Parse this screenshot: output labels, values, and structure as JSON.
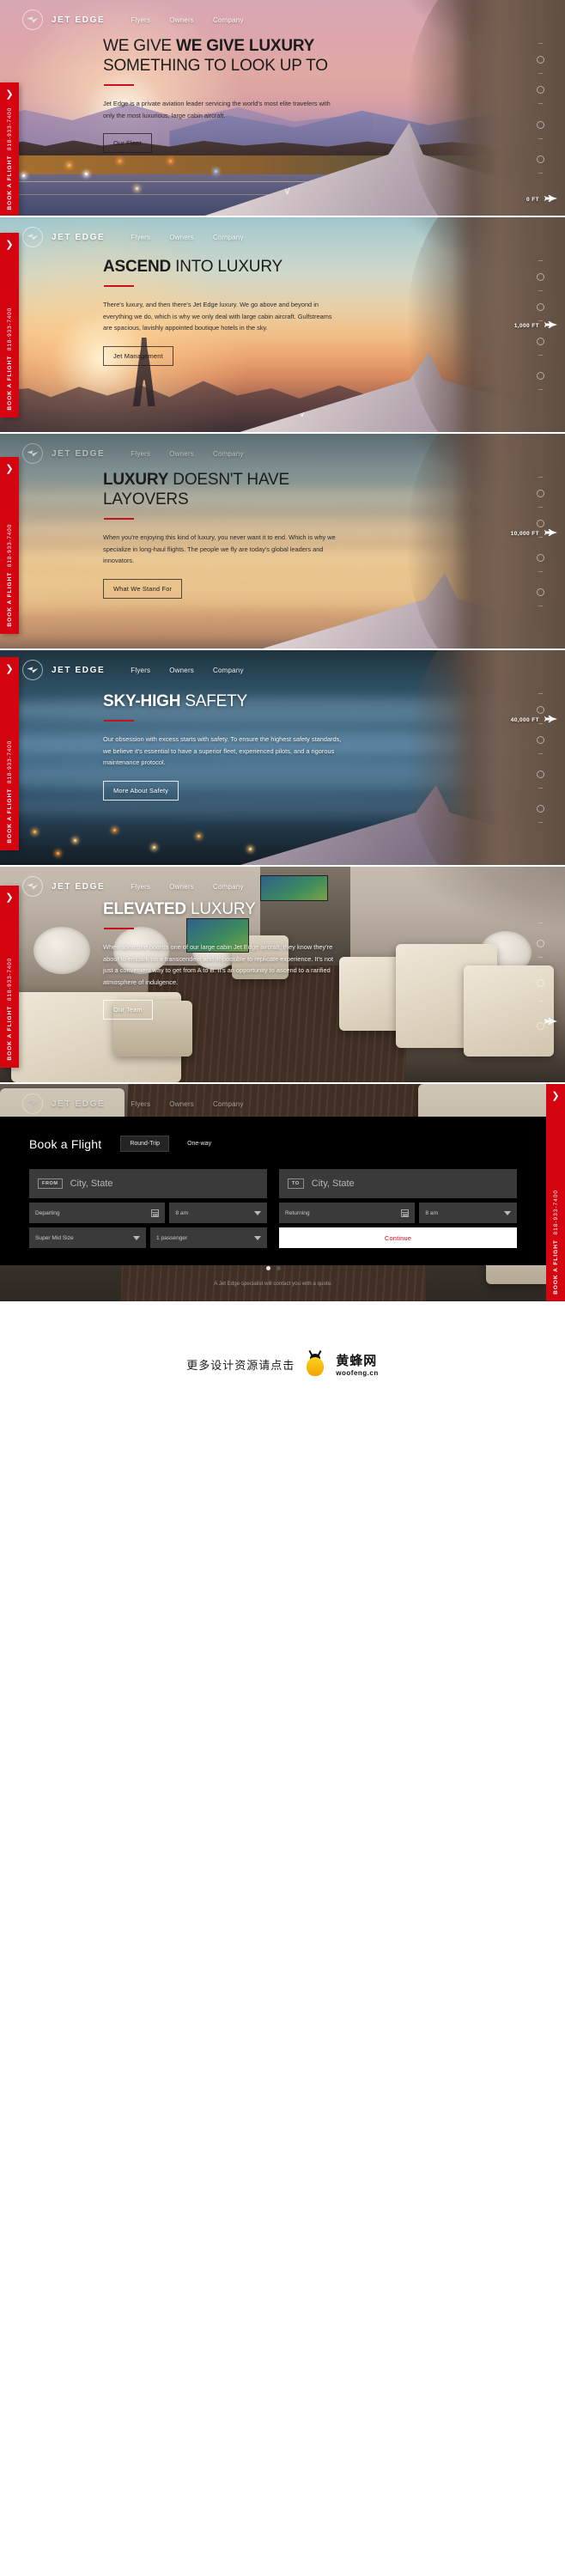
{
  "brand": {
    "name": "JET EDGE",
    "logo_icon": "jet-edge-bird-logo"
  },
  "nav": {
    "links": [
      {
        "label": "Flyers"
      },
      {
        "label": "Owners"
      },
      {
        "label": "Company"
      }
    ]
  },
  "book_tab": {
    "chevron_icon": "chevron-right-icon",
    "label": "BOOK A FLIGHT",
    "phone": "818-933-7400"
  },
  "colors": {
    "accent_red": "#d40511",
    "rule_red": "#c4121f",
    "booking_bg": "#000000"
  },
  "panels": [
    {
      "id": "panel-we-give-luxury",
      "headline_bold": "WE GIVE LUXURY",
      "headline_light": "SOMETHING TO LOOK UP TO",
      "body": "Jet Edge is a private aviation leader servicing the world's most elite travelers with only the most luxurious, large cabin aircraft.",
      "cta": "Our Fleet",
      "altitude": "0 FT",
      "theme": "dark-text"
    },
    {
      "id": "panel-ascend-into-luxury",
      "headline_bold": "ASCEND",
      "headline_light": " INTO LUXURY",
      "body": "There's luxury, and then there's Jet Edge luxury. We go above and beyond in everything we do, which is why we only deal with large cabin aircraft. Gulfstreams are spacious, lavishly appointed boutique hotels in the sky.",
      "cta": "Jet Management",
      "altitude": "1,000 FT",
      "theme": "dark-text"
    },
    {
      "id": "panel-luxury-doesnt-have-layovers",
      "headline_bold": "LUXURY",
      "headline_light": " DOESN'T HAVE LAYOVERS",
      "body": "When you're enjoying this kind of luxury, you never want it to end. Which is why we specialize in long-haul flights. The people we fly are today's global leaders and innovators.",
      "cta": "What We Stand For",
      "altitude": "10,000 FT",
      "theme": "dark-text"
    },
    {
      "id": "panel-sky-high-safety",
      "headline_bold": "SKY-HIGH",
      "headline_light": " SAFETY",
      "body": "Our obsession with excess starts with safety. To ensure the highest safety standards, we believe it's essential to have a superior fleet, experienced pilots, and a rigorous maintenance protocol.",
      "cta": "More About Safety",
      "altitude": "40,000 FT",
      "theme": "light-text"
    },
    {
      "id": "panel-elevated-luxury",
      "headline_bold": "ELEVATED",
      "headline_light": " LUXURY",
      "body": "When someone boards one of our large cabin Jet Edge aircraft, they know they're about to embark on a transcendent and impossible to replicate experience. It's not just a convenient way to get from A to B. It's an opportunity to ascend to a rarified atmosphere of indulgence.",
      "cta": "Our Team",
      "altitude": "",
      "theme": "light-text"
    }
  ],
  "booking": {
    "title": "Book a Flight",
    "trip_round": "Round-Trip",
    "trip_oneway": "One-way",
    "from_tag": "FROM",
    "from_placeholder": "City, State",
    "to_tag": "TO",
    "to_placeholder": "City, State",
    "departing_placeholder": "Departing",
    "departing_time": "8 am",
    "returning_placeholder": "Returning",
    "returning_time": "8 am",
    "aircraft": "Super Mid Size",
    "passengers": "1 passenger",
    "continue": "Continue",
    "disclaimer": "A Jet Edge specialist will contact you with a quote.",
    "calendar_icon": "calendar-icon",
    "caret_icon": "chevron-down-icon"
  },
  "footer": {
    "text_cn": "更多设计资源请点击",
    "site_name": "黄蜂网",
    "site_url": "woofeng.cn",
    "bee_icon": "bee-logo-icon"
  }
}
